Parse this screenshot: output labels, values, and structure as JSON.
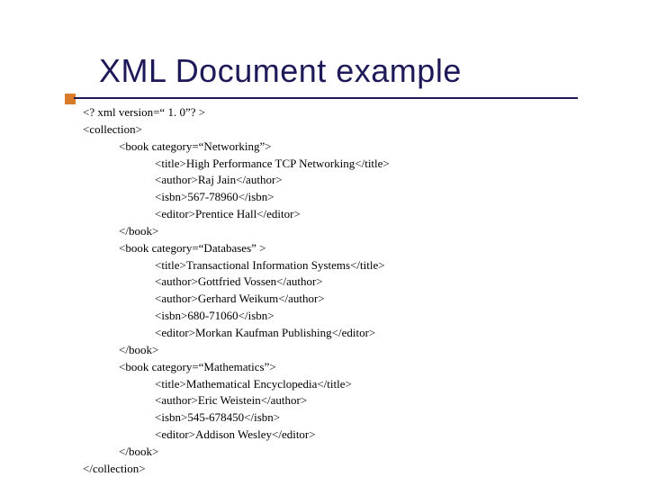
{
  "title": "XML Document example",
  "lines": [
    {
      "indent": 1,
      "text": "<? xml version=“ 1. 0”? >"
    },
    {
      "indent": 1,
      "text": "<collection>"
    },
    {
      "indent": 2,
      "text": "<book category=“Networking”>"
    },
    {
      "indent": 3,
      "text": "<title>High Performance TCP Networking</title>"
    },
    {
      "indent": 3,
      "text": "<author>Raj Jain</author>"
    },
    {
      "indent": 3,
      "text": "<isbn>567-78960</isbn>"
    },
    {
      "indent": 3,
      "text": "<editor>Prentice Hall</editor>"
    },
    {
      "indent": 2,
      "text": "</book>"
    },
    {
      "indent": 2,
      "text": "<book category=“Databases” >"
    },
    {
      "indent": 3,
      "text": "<title>Transactional Information Systems</title>"
    },
    {
      "indent": 3,
      "text": "<author>Gottfried Vossen</author>"
    },
    {
      "indent": 3,
      "text": "<author>Gerhard Weikum</author>"
    },
    {
      "indent": 3,
      "text": "<isbn>680-71060</isbn>"
    },
    {
      "indent": 3,
      "text": "<editor>Morkan Kaufman Publishing</editor>"
    },
    {
      "indent": 2,
      "text": "</book>"
    },
    {
      "indent": 2,
      "text": "<book category=“Mathematics”>"
    },
    {
      "indent": 3,
      "text": "<title>Mathematical Encyclopedia</title>"
    },
    {
      "indent": 3,
      "text": "<author>Eric Weistein</author>"
    },
    {
      "indent": 3,
      "text": "<isbn>545-678450</isbn>"
    },
    {
      "indent": 3,
      "text": "<editor>Addison Wesley</editor>"
    },
    {
      "indent": 2,
      "text": "</book>"
    },
    {
      "indent": 1,
      "text": "</collection>"
    }
  ]
}
